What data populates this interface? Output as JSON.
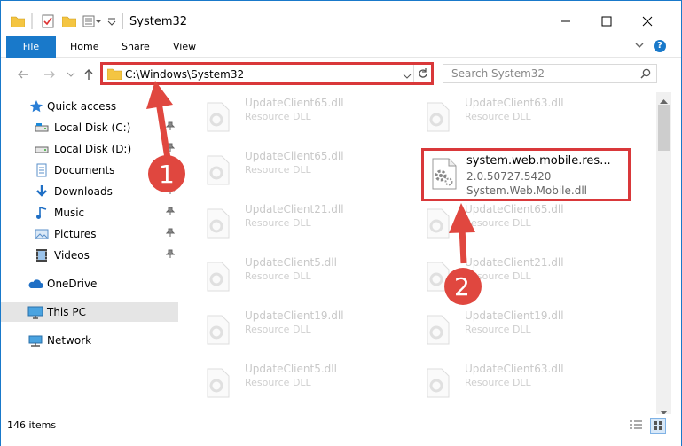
{
  "window": {
    "title": "System32",
    "colors": {
      "accent": "#1979ca",
      "highlight": "#d9383a",
      "folder": "#f4c542"
    }
  },
  "ribbon": {
    "tabs": [
      {
        "label": "File"
      },
      {
        "label": "Home"
      },
      {
        "label": "Share"
      },
      {
        "label": "View"
      }
    ]
  },
  "address": {
    "path": "C:\\Windows\\System32",
    "search_placeholder": "Search System32"
  },
  "sidebar": {
    "items": [
      {
        "label": "Quick access",
        "icon": "star-icon"
      },
      {
        "label": "Local Disk (C:)",
        "icon": "drive-icon",
        "pinned": true
      },
      {
        "label": "Local Disk (D:)",
        "icon": "drive-icon",
        "pinned": true
      },
      {
        "label": "Documents",
        "icon": "documents-icon",
        "pinned": true
      },
      {
        "label": "Downloads",
        "icon": "download-icon",
        "pinned": true
      },
      {
        "label": "Music",
        "icon": "music-icon",
        "pinned": true
      },
      {
        "label": "Pictures",
        "icon": "pictures-icon",
        "pinned": true
      },
      {
        "label": "Videos",
        "icon": "videos-icon",
        "pinned": true
      },
      {
        "label": "OneDrive",
        "icon": "cloud-icon"
      },
      {
        "label": "This PC",
        "icon": "computer-icon",
        "selected": true
      },
      {
        "label": "Network",
        "icon": "network-icon"
      }
    ]
  },
  "files": {
    "left": [
      {
        "name": "UpdateClient65.dll",
        "type": "Resource DLL"
      },
      {
        "name": "UpdateClient65.dll",
        "type": "Resource DLL"
      },
      {
        "name": "UpdateClient21.dll",
        "type": "Resource DLL"
      },
      {
        "name": "UpdateClient5.dll",
        "type": "Resource DLL"
      },
      {
        "name": "UpdateClient19.dll",
        "type": "Resource DLL"
      },
      {
        "name": "UpdateClient5.dll",
        "type": "Resource DLL"
      }
    ],
    "right": [
      {
        "name": "UpdateClient63.dll",
        "type": "Resource DLL"
      },
      {
        "name": "UpdateClient65.dll",
        "type": "Resource DLL"
      },
      {
        "name": "UpdateClient21.dll",
        "type": "Resource DLL"
      },
      {
        "name": "UpdateClient19.dll",
        "type": "Resource DLL"
      },
      {
        "name": "UpdateClient63.dll",
        "type": "Resource DLL"
      }
    ],
    "highlighted": {
      "name": "system.web.mobile.res...",
      "version": "2.0.50727.5420",
      "description": "System.Web.Mobile.dll"
    }
  },
  "annotations": {
    "badge1": "1",
    "badge2": "2"
  },
  "status": {
    "count": "146 items"
  }
}
